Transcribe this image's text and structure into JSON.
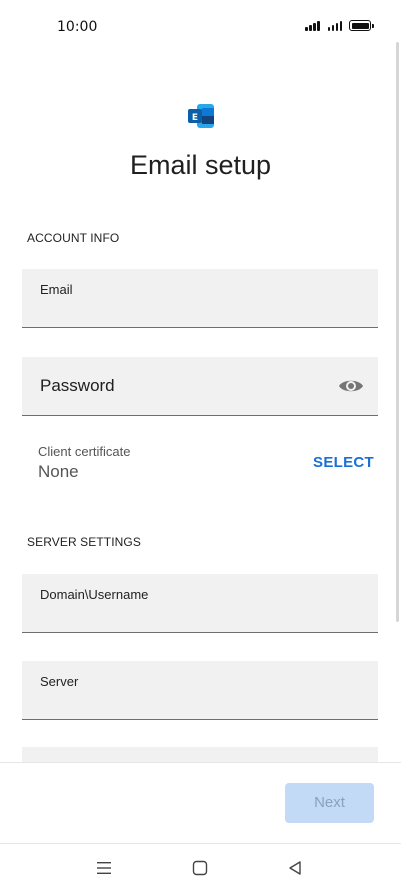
{
  "status_bar": {
    "time": "10:00"
  },
  "header": {
    "title": "Email setup"
  },
  "sections": {
    "account_info": "ACCOUNT INFO",
    "server_settings": "SERVER SETTINGS"
  },
  "fields": {
    "email_label": "Email",
    "password_placeholder": "Password",
    "domain_username_label": "Domain\\Username",
    "server_label": "Server"
  },
  "client_certificate": {
    "label": "Client certificate",
    "value": "None",
    "action": "SELECT"
  },
  "footer": {
    "next_label": "Next"
  },
  "colors": {
    "accent": "#1a6fd8",
    "next_disabled_bg": "#c3daf6",
    "field_bg": "#f1f1f1"
  },
  "icons": [
    "exchange-logo-icon",
    "eye-icon",
    "menu-icon",
    "home-square-icon",
    "back-triangle-icon"
  ]
}
